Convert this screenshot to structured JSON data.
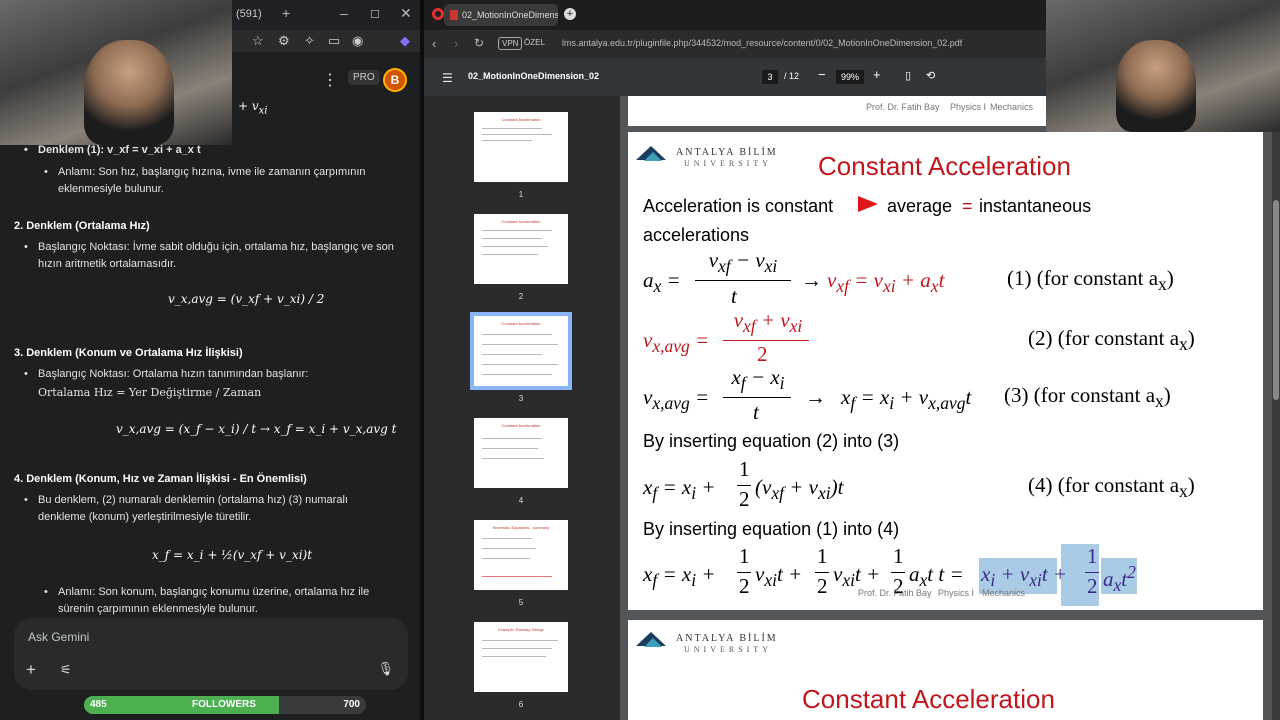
{
  "gemini": {
    "tab_count": "(591)",
    "pro_label": "PRO",
    "avatar_letter": "B",
    "sections": {
      "eq1_line": "Denklem (1): v_xf = v_xi + a_x t",
      "eq1_meaning": "Anlamı: Son hız, başlangıç hızına, ivme ile zamanın çarpımının eklenmesiyle bulunur.",
      "h2": "2. Denklem (Ortalama Hız)",
      "h2_start": "Başlangıç Noktası: İvme sabit olduğu için, ortalama hız, başlangıç ve son hızın aritmetik ortalamasıdır.",
      "h2_eq": "v_x,avg = (v_xf + v_xi) / 2",
      "h3": "3. Denklem (Konum ve Ortalama Hız İlişkisi)",
      "h3_start": "Başlangıç Noktası: Ortalama hızın tanımından başlanır:",
      "h3_formula": "Ortalama Hız = Yer Değiştirme / Zaman",
      "h3_eq": "v_x,avg = (x_f − x_i) / t → x_f = x_i + v_x,avg t",
      "h4": "4. Denklem (Konum, Hız ve Zaman İlişkisi - En Önemlisi)",
      "h4_text": "Bu denklem, (2) numaralı denklemin (ortalama hız) (3) numaralı denkleme (konum) yerleştirilmesiyle türetilir.",
      "h4_eq": "x_f = x_i + ½(v_xf + v_xi)t",
      "h4_meaning": "Anlamı: Son konum, başlangıç konumu üzerine, ortalama hız ile sürenin çarpımının eklenmesiyle bulunur."
    },
    "ask_placeholder": "Ask Gemini",
    "followers": {
      "current": "485",
      "label": "FOLLOWERS",
      "goal": "700",
      "progress_fraction": 0.69
    }
  },
  "browser": {
    "tab_title": "02_MotionInOneDimensio",
    "vpn_label": "VPN",
    "private_label": "ÖZEL",
    "url": "lms.antalya.edu.tr/pluginfile.php/344532/mod_resource/content/0/02_MotionInOneDimension_02.pdf",
    "pdf_name": "02_MotionInOneDimension_02",
    "page_current": "3",
    "page_total": "/ 12",
    "zoom": "99%"
  },
  "thumbnails": [
    {
      "num": "1",
      "title": "Constant Acceleration"
    },
    {
      "num": "2",
      "title": "Constant Acceleration"
    },
    {
      "num": "3",
      "title": "Constant Acceleration"
    },
    {
      "num": "4",
      "title": "Constant Acceleration"
    },
    {
      "num": "5",
      "title": "Kinematic Equations - summary"
    },
    {
      "num": "6",
      "title": "Example: Runway Design"
    }
  ],
  "slide": {
    "header_author": "Prof. Dr. Fatih Bay",
    "header_course": "Physics I",
    "header_topic": "Mechanics",
    "university_name": "ANTALYA BİLİM",
    "university_sub": "UNIVERSITY",
    "title": "Constant Acceleration",
    "line1a": "Acceleration is constant",
    "line1b": "average",
    "line1c": "=",
    "line1d": "instantaneous",
    "line2": "accelerations",
    "eq1_label": "(1) (for constant a",
    "eq2_label": "(2) (for constant a",
    "eq3_label": "(3) (for constant a",
    "insert1": "By inserting equation (2) into (3)",
    "eq4_label": "(4) (for constant a",
    "insert2": "By inserting equation (1) into (4)",
    "next_title": "Constant Acceleration"
  }
}
